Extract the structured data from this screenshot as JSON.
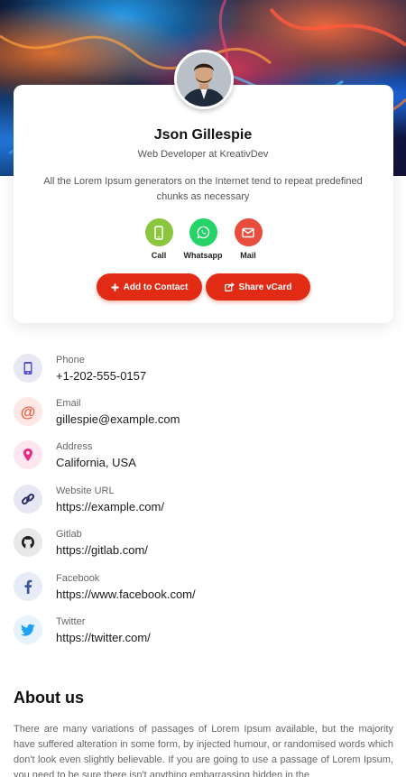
{
  "profile": {
    "name": "Json Gillespie",
    "title": "Web Developer at KreativDev",
    "bio": "All the Lorem Ipsum generators on the Internet tend to repeat predefined chunks as necessary"
  },
  "quick_actions": [
    {
      "label": "Call",
      "icon": "phone-icon",
      "color": "#8cc63f"
    },
    {
      "label": "Whatsapp",
      "icon": "whatsapp-icon",
      "color": "#25d366"
    },
    {
      "label": "Mail",
      "icon": "mail-icon",
      "color": "#e74c3c"
    }
  ],
  "buttons": {
    "add_contact": "Add to Contact",
    "share_vcard": "Share vCard",
    "accent": "#e12b14"
  },
  "contacts": [
    {
      "label": "Phone",
      "value": "+1-202-555-0157",
      "icon": "phone-icon"
    },
    {
      "label": "Email",
      "value": "gillespie@example.com",
      "icon": "at-icon"
    },
    {
      "label": "Address",
      "value": "California, USA",
      "icon": "location-pin-icon"
    },
    {
      "label": "Website URL",
      "value": "https://example.com/",
      "icon": "link-icon"
    },
    {
      "label": "Gitlab",
      "value": "https://gitlab.com/",
      "icon": "github-icon"
    },
    {
      "label": "Facebook",
      "value": "https://www.facebook.com/",
      "icon": "facebook-icon"
    },
    {
      "label": "Twitter",
      "value": "https://twitter.com/",
      "icon": "twitter-icon"
    }
  ],
  "about": {
    "heading": "About us",
    "text": "There are many variations of passages of Lorem Ipsum available, but the majority have suffered alteration in some form, by injected humour, or randomised words which don't look even slightly believable. If you are going to use a passage of Lorem Ipsum, you need to be sure there isn't anything embarrassing hidden in the"
  }
}
